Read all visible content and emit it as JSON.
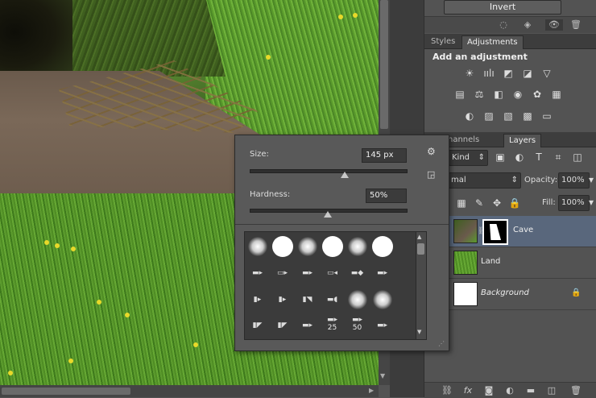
{
  "properties": {
    "invert_label": "Invert",
    "footer_icons": [
      "clip-icon",
      "eye-visibility-icon",
      "view-previous-icon",
      "reset-icon",
      "delete-icon"
    ]
  },
  "adjustments_panel": {
    "tabs": [
      {
        "label": "Styles",
        "active": false
      },
      {
        "label": "Adjustments",
        "active": true
      }
    ],
    "heading": "Add an adjustment",
    "row1_icons": [
      "brightness-contrast-icon",
      "levels-icon",
      "curves-icon",
      "exposure-icon",
      "vibrance-icon"
    ],
    "row2_icons": [
      "hue-saturation-icon",
      "color-balance-icon",
      "black-white-icon",
      "photo-filter-icon",
      "channel-mixer-icon",
      "color-lookup-icon"
    ],
    "row3_icons": [
      "invert-icon",
      "posterize-icon",
      "threshold-icon",
      "selective-color-icon",
      "gradient-map-icon"
    ]
  },
  "layers_panel": {
    "tabs": [
      {
        "label": "s",
        "active": false
      },
      {
        "label": "Channels",
        "active": false
      },
      {
        "label": "Layers",
        "active": true
      }
    ],
    "filter_kind": "Kind",
    "blend_mode": "mal",
    "opacity_label": "Opacity:",
    "opacity_value": "100%",
    "fill_label": "Fill:",
    "fill_value": "100%",
    "layers": [
      {
        "name": "Cave",
        "selected": true,
        "has_mask": true,
        "italic": false,
        "locked": false
      },
      {
        "name": "Land",
        "selected": false,
        "has_mask": false,
        "italic": false,
        "locked": false
      },
      {
        "name": "Background",
        "selected": false,
        "has_mask": false,
        "italic": true,
        "locked": true
      }
    ]
  },
  "brush_popup": {
    "size_label": "Size:",
    "size_value": "145 px",
    "size_fraction": 0.61,
    "hardness_label": "Hardness:",
    "hardness_value": "50%",
    "hardness_fraction": 0.5,
    "numbers": [
      "25",
      "50"
    ]
  },
  "colors": {
    "selected_layer": "#59677c",
    "panel_bg": "#535353"
  }
}
